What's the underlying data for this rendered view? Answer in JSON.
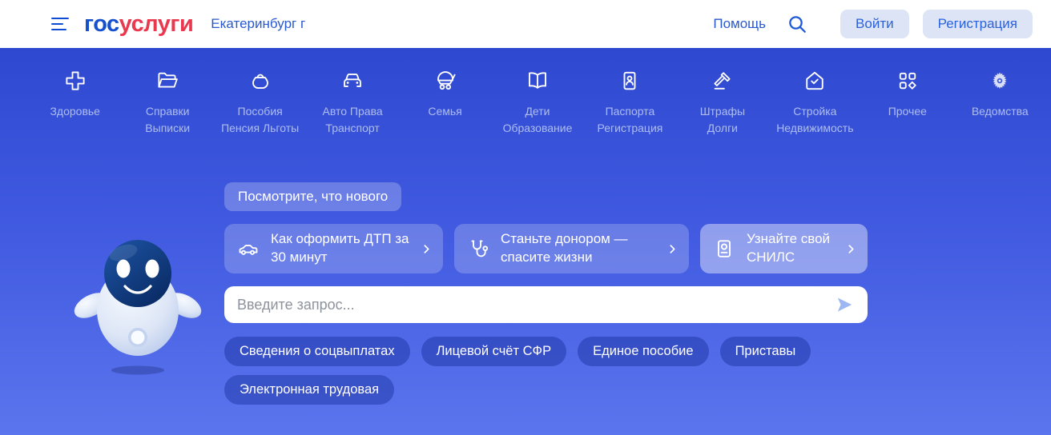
{
  "header": {
    "logo_blue": "гос",
    "logo_red": "услуги",
    "location": "Екатеринбург г",
    "help_label": "Помощь",
    "login_label": "Войти",
    "register_label": "Регистрация"
  },
  "nav": {
    "items": [
      {
        "icon": "health-cross",
        "label": "Здоровье"
      },
      {
        "icon": "folder",
        "label": "Справки\nВыписки"
      },
      {
        "icon": "purse",
        "label": "Пособия\nПенсия Льготы"
      },
      {
        "icon": "car-front",
        "label": "Авто Права\nТранспорт"
      },
      {
        "icon": "stroller",
        "label": "Семья"
      },
      {
        "icon": "book",
        "label": "Дети\nОбразование"
      },
      {
        "icon": "passport",
        "label": "Паспорта\nРегистрация"
      },
      {
        "icon": "gavel",
        "label": "Штрафы\nДолги"
      },
      {
        "icon": "house-check",
        "label": "Стройка\nНедвижимость"
      },
      {
        "icon": "grid",
        "label": "Прочее"
      },
      {
        "icon": "eagle",
        "label": "Ведомства"
      }
    ]
  },
  "hero": {
    "whats_new_label": "Посмотрите, что нового",
    "cards": [
      {
        "icon": "car-side",
        "label": "Как оформить ДТП за 30 минут",
        "highlight": false
      },
      {
        "icon": "stethoscope",
        "label": "Станьте донором — спасите жизни",
        "highlight": false
      },
      {
        "icon": "snils-card",
        "label": "Узнайте свой СНИЛС",
        "highlight": true
      }
    ],
    "search": {
      "placeholder": "Введите запрос...",
      "value": ""
    },
    "chips": [
      "Сведения о соцвыплатах",
      "Лицевой счёт СФР",
      "Единое пособие",
      "Приставы",
      "Электронная трудовая"
    ]
  },
  "colors": {
    "brand_blue": "#0d4cd3",
    "logo_red": "#e8394f",
    "header_link_blue": "#2859cf",
    "header_button_bg": "#dce4f6",
    "bg_gradient_top": "#2e49d0",
    "bg_gradient_bottom": "#5b75ee",
    "nav_label": "#aebdf1",
    "chip_bg": "rgba(18,43,150,0.42)"
  }
}
